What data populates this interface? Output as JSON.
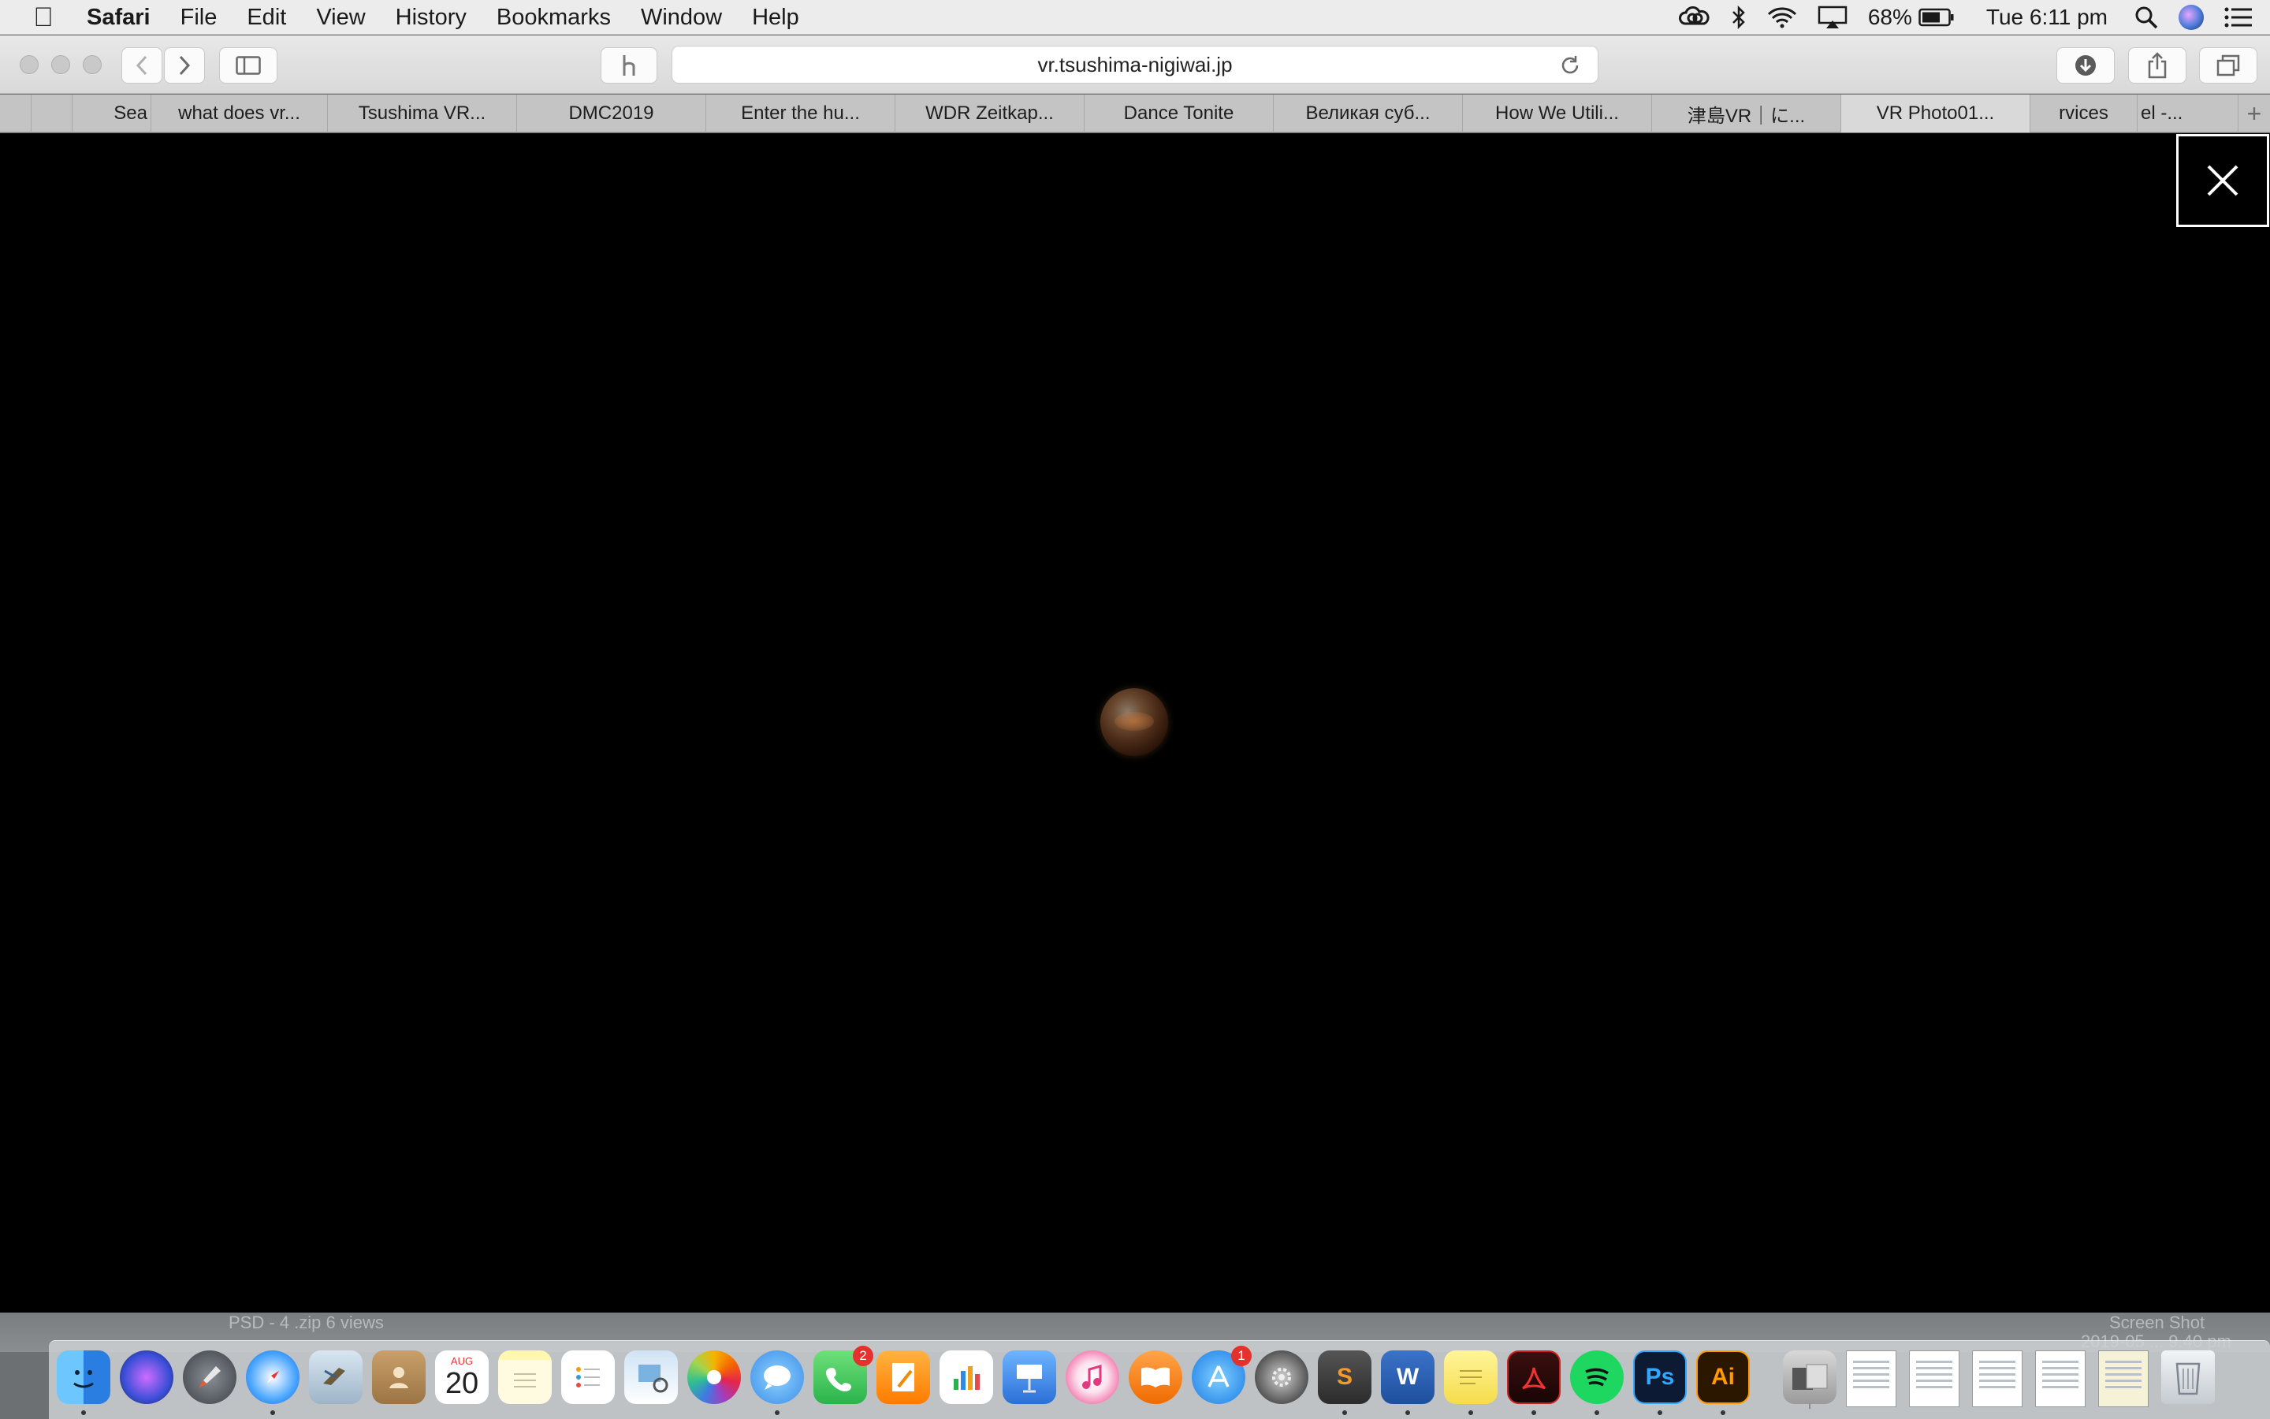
{
  "menubar": {
    "apple": "",
    "items": [
      "Safari",
      "File",
      "Edit",
      "View",
      "History",
      "Bookmarks",
      "Window",
      "Help"
    ],
    "battery": "68%",
    "clock": "Tue 6:11 pm"
  },
  "toolbar": {
    "url": "vr.tsushima-nigiwai.jp"
  },
  "tabs": [
    {
      "label": ""
    },
    {
      "label": "Sea"
    },
    {
      "label": "what does vr..."
    },
    {
      "label": "Tsushima VR..."
    },
    {
      "label": "DMC2019"
    },
    {
      "label": "Enter the hu..."
    },
    {
      "label": "WDR Zeitkap..."
    },
    {
      "label": "Dance Tonite"
    },
    {
      "label": "Великая суб..."
    },
    {
      "label": "How We Utili..."
    },
    {
      "label": "津島VR｜に..."
    },
    {
      "label": "VR Photo01..."
    },
    {
      "label": "rvices"
    },
    {
      "label": "el -..."
    },
    {
      "label": "+"
    }
  ],
  "desktop": {
    "left_text": "PSD - 4 .zip 6 views",
    "right_text_1": "Screen Shot",
    "right_text_2": "2019-05 ... 9.40 pm"
  },
  "dock": {
    "calendar_month": "AUG",
    "calendar_day": "20",
    "facetime_badge": "2",
    "appstore_badge": "1",
    "ps_label": "Ps",
    "ai_label": "Ai"
  }
}
